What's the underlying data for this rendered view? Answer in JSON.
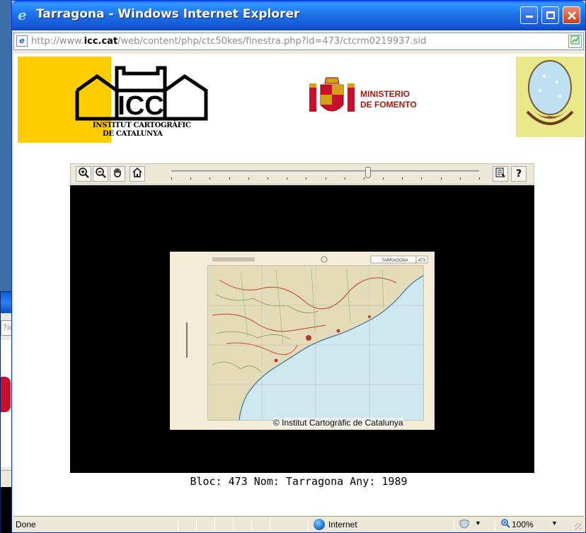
{
  "background_window": {
    "address_fragment": "?ic"
  },
  "window": {
    "title": "Tarragona - Windows Internet Explorer",
    "app_icon": "e"
  },
  "address": {
    "prefix": "http://www.",
    "domain": "icc.cat",
    "path": "/web/content/php/ctc50kes/finestra.php?id=473/ctcrm0219937.sid"
  },
  "header": {
    "icc_wordmark": "ICC",
    "icc_name_line1": "INSTITUT CARTOGRÀFIC",
    "icc_name_line2": "DE CATALUNYA",
    "fomento_line1": "MINISTERIO",
    "fomento_line2": "DE FOMENTO"
  },
  "toolbar": {
    "zoom_in_icon": "zoom-in-icon",
    "zoom_out_icon": "zoom-out-icon",
    "pan_icon": "hand-icon",
    "home_icon": "home-icon",
    "props_icon": "properties-icon",
    "help_label": "?",
    "zoom_level": 0.64
  },
  "map": {
    "copyright": "© Institut Cartogràfic de Catalunya",
    "caption": "Bloc: 473 Nom: Tarragona Any: 1989",
    "sheet_title": "TARRAGONA",
    "sheet_number": "473"
  },
  "statusbar": {
    "text": "Done",
    "zone": "Internet",
    "zoom": "100%"
  },
  "colors": {
    "icc_yellow": "#ffcc00",
    "fomento_red": "#a3180c",
    "titlebar_blue": "#0a47c4"
  }
}
